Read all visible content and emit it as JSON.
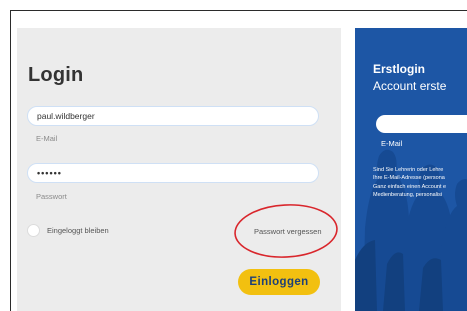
{
  "login": {
    "title": "Login",
    "email_value": "paul.wildberger",
    "email_label": "E-Mail",
    "password_value": "••••••",
    "password_label": "Passwort",
    "remember_label": "Eingeloggt bleiben",
    "forgot_label": "Passwort vergessen",
    "submit_label": "Einloggen"
  },
  "signup": {
    "title": "Erstlogin",
    "subtitle": "Account erste",
    "email_label": "E-Mail",
    "text_lines": [
      "Sind Sie Lehrerin oder Lehre",
      "Ihre E-Mail-Adresse (persona",
      "Ganz einfach einen Account e",
      "Medienberatung, personalisi"
    ]
  },
  "colors": {
    "brand_blue": "#1d56a5",
    "button_yellow": "#f2c010",
    "annotation_red": "#d9262c"
  }
}
